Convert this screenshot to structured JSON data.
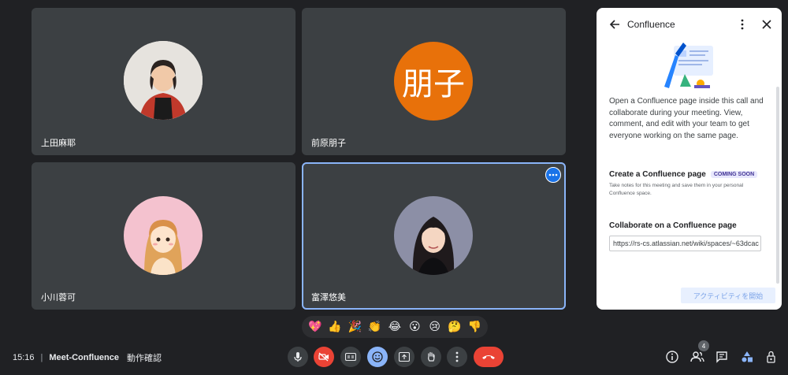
{
  "participants": [
    {
      "name": "上田麻耶",
      "avatar": "photo-woman-red-cardigan"
    },
    {
      "name": "前原朋子",
      "initials": "朋子",
      "avatar_color": "#e8710a"
    },
    {
      "name": "小川蓉可",
      "avatar": "illustrated-woman"
    },
    {
      "name": "富澤悠美",
      "avatar": "photo-woman-dark-hair"
    }
  ],
  "panel": {
    "title": "Confluence",
    "description": "Open a Confluence page inside this call and collaborate during your meeting. View, comment, and edit with your team to get everyone working on the same page.",
    "create_title": "Create a Confluence page",
    "coming_soon": "COMING SOON",
    "create_sub": "Take notes for this meeting and save them in your personal Confluence space.",
    "collab_title": "Collaborate on a Confluence page",
    "url_value": "https://rs-cs.atlassian.net/wiki/spaces/~63dcac",
    "start_button": "アクティビティを開始"
  },
  "reactions": [
    "💖",
    "👍",
    "🎉",
    "👏",
    "😂",
    "😮",
    "😢",
    "🤔",
    "👎"
  ],
  "meeting": {
    "time": "15:16",
    "separator": "|",
    "name": "Meet-Confluence",
    "subtitle": "動作確認"
  },
  "people_count": "4",
  "colors": {
    "accent": "#8ab4f8",
    "end_call": "#ea4335",
    "tile_bg": "#3c4043",
    "background": "#202124"
  }
}
